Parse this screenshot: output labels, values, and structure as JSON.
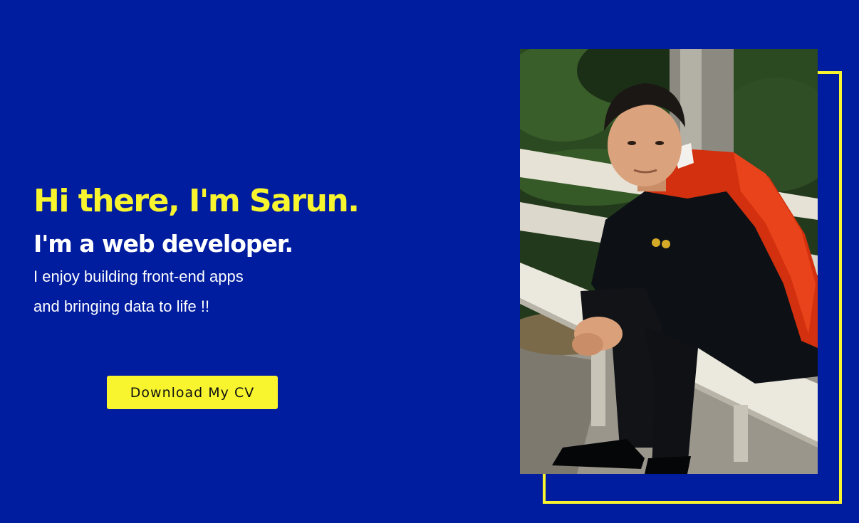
{
  "hero": {
    "greeting": "Hi there, I'm Sarun.",
    "role": "I'm a web developer.",
    "tagline_line1": "I enjoy building front-end apps",
    "tagline_line2": "and bringing data to life !!"
  },
  "cta": {
    "download_label": "Download My CV"
  },
  "colors": {
    "background": "#001c9f",
    "accent": "#f8f52f",
    "text": "#ffffff"
  }
}
